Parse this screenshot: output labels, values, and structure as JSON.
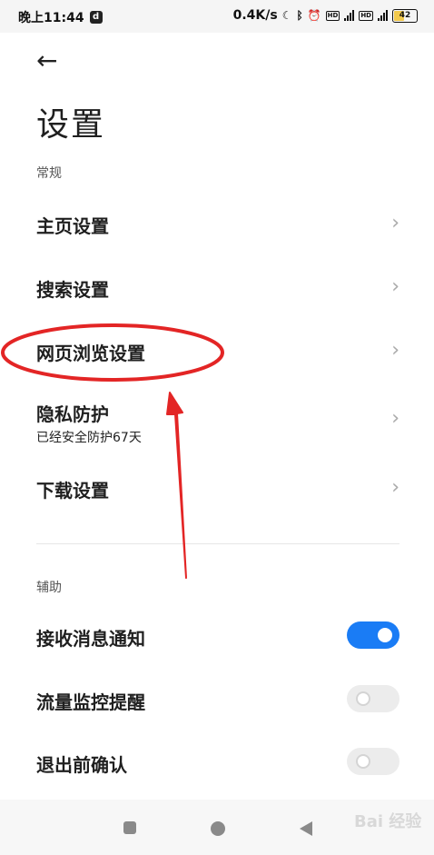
{
  "status_bar": {
    "time": "晚上11:44",
    "app_icon": "d",
    "speed": "0.4K/s",
    "icons": [
      "moon-icon",
      "bluetooth-icon",
      "alarm-icon",
      "hd-icon",
      "signal-icon",
      "hd-icon",
      "signal-icon"
    ],
    "battery": "42"
  },
  "header": {
    "back_icon": "arrow-left-icon",
    "title": "设置"
  },
  "general": {
    "label": "常规",
    "items": [
      {
        "label": "主页设置",
        "sub": ""
      },
      {
        "label": "搜索设置",
        "sub": ""
      },
      {
        "label": "网页浏览设置",
        "sub": ""
      },
      {
        "label": "隐私防护",
        "sub": "已经安全防护67天"
      },
      {
        "label": "下载设置",
        "sub": ""
      }
    ]
  },
  "assist": {
    "label": "辅助",
    "items": [
      {
        "label": "接收消息通知",
        "on": true
      },
      {
        "label": "流量监控提醒",
        "on": false
      },
      {
        "label": "退出前确认",
        "on": false
      }
    ]
  },
  "annotation": {
    "shape": "red-ellipse-with-arrow",
    "color": "#e32525"
  },
  "watermark": "Bai 经验"
}
